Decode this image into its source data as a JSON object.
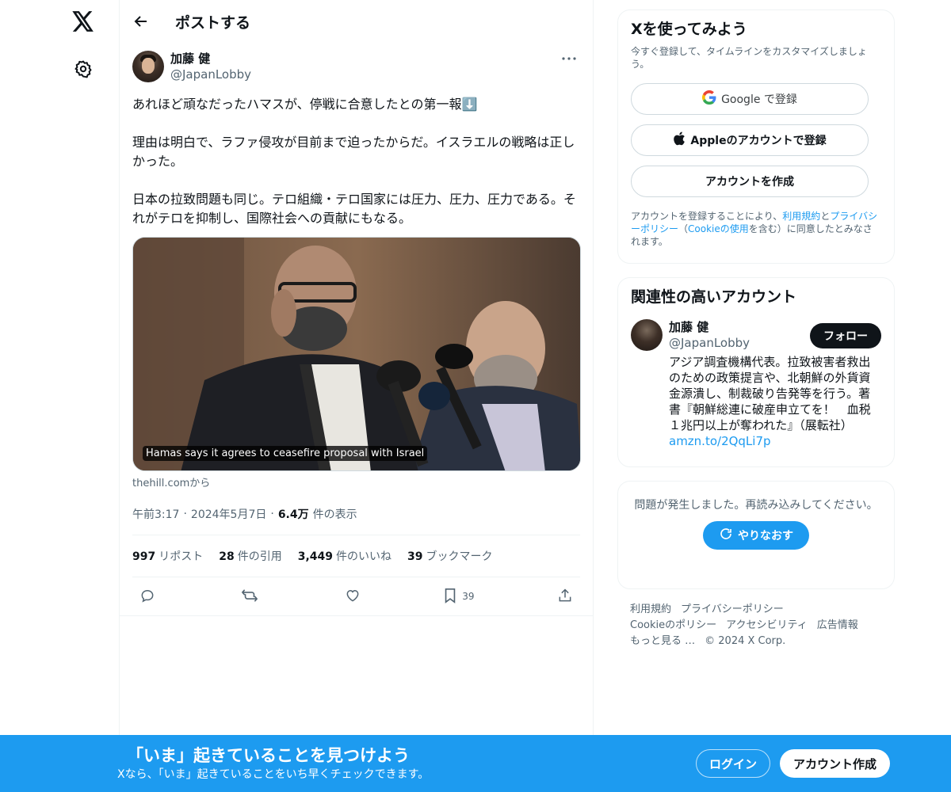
{
  "nav": {
    "logo_icon": "x-logo-icon",
    "settings_icon": "gear-icon"
  },
  "header": {
    "title": "ポストする"
  },
  "post": {
    "author_name": "加藤 健",
    "author_handle": "@JapanLobby",
    "text": "あれほど頑なだったハマスが、停戦に合意したとの第一報⬇️\n\n理由は明白で、ラファ侵攻が目前まで迫ったからだ。イスラエルの戦略は正しかった。\n\n日本の拉致問題も同じ。テロ組織・テロ国家には圧力、圧力、圧力である。それがテロを抑制し、国際社会への貢献にもなる。",
    "media_caption": "Hamas says it agrees to ceasefire proposal with Israel",
    "source": "thehill.comから",
    "time": "午前3:17",
    "date": "2024年5月7日",
    "views_count": "6.4万",
    "views_label": "件の表示",
    "stats": {
      "reposts_count": "997",
      "reposts_label": "リポスト",
      "quotes_count": "28",
      "quotes_label": "件の引用",
      "likes_count": "3,449",
      "likes_label": "件のいいね",
      "bookmarks_count": "39",
      "bookmarks_label": "ブックマーク"
    },
    "actions": {
      "bookmark_count": "39"
    }
  },
  "signup_card": {
    "title": "Xを使ってみよう",
    "subtitle": "今すぐ登録して、タイムラインをカスタマイズしましょう。",
    "google_label": "Google で登録",
    "apple_label": "Appleのアカウントで登録",
    "create_label": "アカウントを作成",
    "legal_1": "アカウントを登録することにより、",
    "legal_terms": "利用規約",
    "legal_2": "と",
    "legal_privacy": "プライバシーポリシー",
    "legal_3": "（",
    "legal_cookie": "Cookieの使用",
    "legal_4": "を含む）に同意したとみなされます。"
  },
  "related": {
    "title": "関連性の高いアカウント",
    "name": "加藤 健",
    "handle": "@JapanLobby",
    "follow_label": "フォロー",
    "bio": "アジア調査機構代表。拉致被害者救出のための政策提言や、北朝鮮の外貨資金源潰し、制裁破り告発等を行う。著書『朝鮮総連に破産申立てを！　血税１兆円以上が奪われた』（展転社）",
    "bio_link": "amzn.to/2QqLi7p"
  },
  "error_card": {
    "text": "問題が発生しました。再読み込みしてください。",
    "retry_label": "やりなおす"
  },
  "footer": {
    "terms": "利用規約",
    "privacy": "プライバシーポリシー",
    "cookie": "Cookieのポリシー",
    "accessibility": "アクセシビリティ",
    "ads": "広告情報",
    "more": "もっと見る …",
    "copyright": "© 2024 X Corp."
  },
  "banner": {
    "title": "「いま」起きていることを見つけよう",
    "subtitle": "Xなら、「いま」起きていることをいち早くチェックできます。",
    "login_label": "ログイン",
    "signup_label": "アカウント作成"
  },
  "colors": {
    "accent": "#1d9bf0",
    "text": "#0f1419",
    "secondary": "#536471",
    "border": "#eff3f4"
  }
}
